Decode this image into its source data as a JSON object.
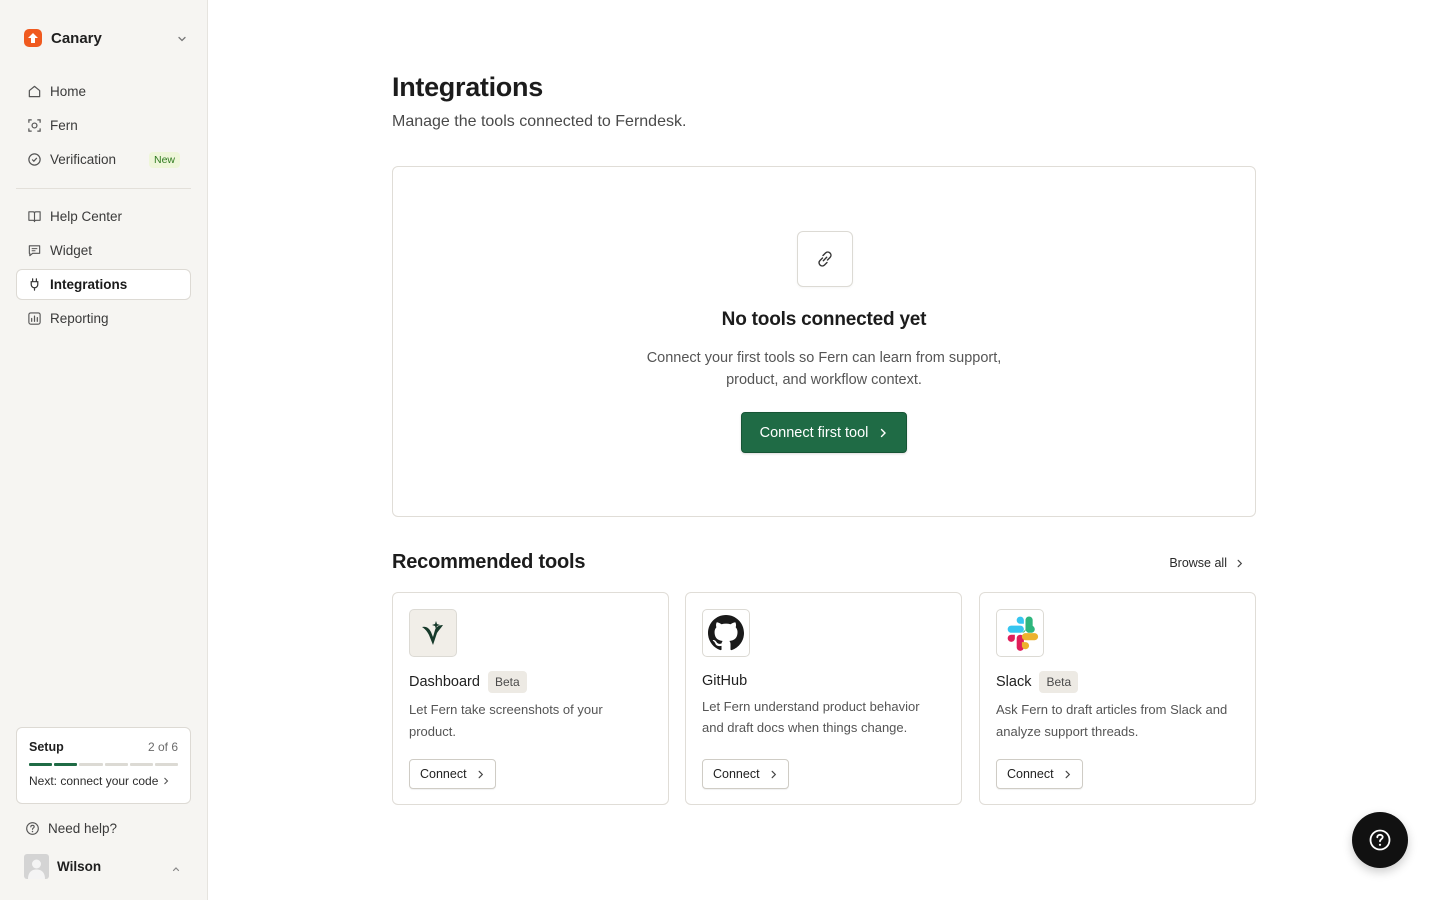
{
  "workspace": {
    "name": "Canary"
  },
  "nav_primary": [
    {
      "label": "Home",
      "icon": "home-icon"
    },
    {
      "label": "Fern",
      "icon": "fern-scan-icon"
    },
    {
      "label": "Verification",
      "icon": "check-circle-icon",
      "badge": "New"
    }
  ],
  "nav_secondary": [
    {
      "label": "Help Center",
      "icon": "book-icon"
    },
    {
      "label": "Widget",
      "icon": "chat-bubble-icon"
    },
    {
      "label": "Integrations",
      "icon": "plug-icon",
      "active": true
    },
    {
      "label": "Reporting",
      "icon": "chart-icon"
    }
  ],
  "setup": {
    "title": "Setup",
    "count": "2 of 6",
    "steps_total": 6,
    "steps_done": 2,
    "next": "Next: connect your code"
  },
  "help": {
    "label": "Need help?"
  },
  "user": {
    "name": "Wilson"
  },
  "page": {
    "title": "Integrations",
    "subtitle": "Manage the tools connected to Ferndesk."
  },
  "empty_state": {
    "title": "No tools connected yet",
    "description": "Connect your first tools so Fern can learn from support, product, and workflow context.",
    "button": "Connect first tool"
  },
  "recommended": {
    "title": "Recommended tools",
    "browse_all": "Browse all",
    "tools": [
      {
        "name": "Dashboard",
        "badge": "Beta",
        "description": "Let Fern take screenshots of your product.",
        "button": "Connect"
      },
      {
        "name": "GitHub",
        "description": "Let Fern understand product behavior and draft docs when things change.",
        "button": "Connect"
      },
      {
        "name": "Slack",
        "badge": "Beta",
        "description": "Ask Fern to draft articles from Slack and analyze support threads.",
        "button": "Connect"
      }
    ]
  },
  "colors": {
    "accent": "#1f6b45",
    "brand": "#f05a1f",
    "sidebar_bg": "#f6f5f2"
  }
}
